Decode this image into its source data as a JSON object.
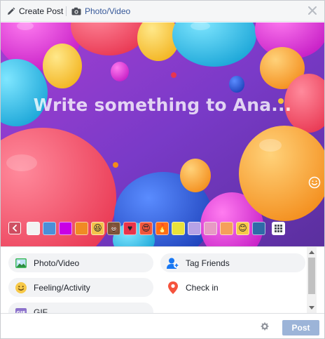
{
  "header": {
    "create_post_label": "Create Post",
    "photo_video_label": "Photo/Video"
  },
  "composer": {
    "prompt_text": "Write something to Ana..."
  },
  "background_picker": {
    "swatches": [
      {
        "name": "white",
        "color": "#f2f2f2",
        "glyph": ""
      },
      {
        "name": "landscape",
        "color": "#4a8fd8",
        "glyph": ""
      },
      {
        "name": "magenta",
        "color": "#c800e6",
        "glyph": ""
      },
      {
        "name": "orange",
        "color": "#f08a24",
        "glyph": ""
      },
      {
        "name": "laughing-emoji",
        "color": "#f3c24a",
        "glyph": "😆"
      },
      {
        "name": "poop-emoji",
        "color": "#7a5237",
        "glyph": "💩"
      },
      {
        "name": "heart",
        "color": "#e8344a",
        "glyph": "♥"
      },
      {
        "name": "heart-eyes-emoji",
        "color": "#f0563b",
        "glyph": "😍"
      },
      {
        "name": "fire",
        "color": "#ff6b1a",
        "glyph": "🔥"
      },
      {
        "name": "yellow-figure",
        "color": "#e9e23a",
        "glyph": ""
      },
      {
        "name": "lavender",
        "color": "#b7a2e6",
        "glyph": ""
      },
      {
        "name": "pink-pattern",
        "color": "#e79ac4",
        "glyph": ""
      },
      {
        "name": "coral-pattern",
        "color": "#f5a05a",
        "glyph": ""
      },
      {
        "name": "smile-emoji",
        "color": "#f7c948",
        "glyph": "😊"
      },
      {
        "name": "blue-leaves",
        "color": "#2f6aa8",
        "glyph": ""
      }
    ]
  },
  "options": {
    "photo_video": "Photo/Video",
    "feeling_activity": "Feeling/Activity",
    "gif": "GIF",
    "tag_friends": "Tag Friends",
    "check_in": "Check in"
  },
  "footer": {
    "post_label": "Post"
  },
  "colors": {
    "link_blue": "#365899",
    "post_disabled": "#9cb4d8",
    "option_bg": "#f2f3f5"
  }
}
